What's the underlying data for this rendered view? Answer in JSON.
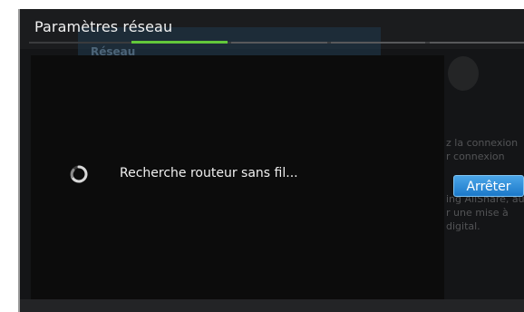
{
  "window": {
    "title": "Paramètres réseau"
  },
  "background_tab": {
    "label": "Réseau"
  },
  "background_text": {
    "lines_top": [
      "z la connexion",
      "r connexion"
    ],
    "lines_bottom": [
      "ing AllShare, au",
      "r une mise à",
      "digital."
    ]
  },
  "stop_button": {
    "label": "Arrêter"
  },
  "dialog": {
    "message": "Recherche routeur sans fil..."
  },
  "progress": {
    "step": 2,
    "total_steps": 5
  },
  "colors": {
    "accent_progress": "#63c83b",
    "button_blue": "#1b78c9"
  },
  "icons": {
    "spinner": "loading-spinner-icon",
    "network": "network-icon"
  }
}
